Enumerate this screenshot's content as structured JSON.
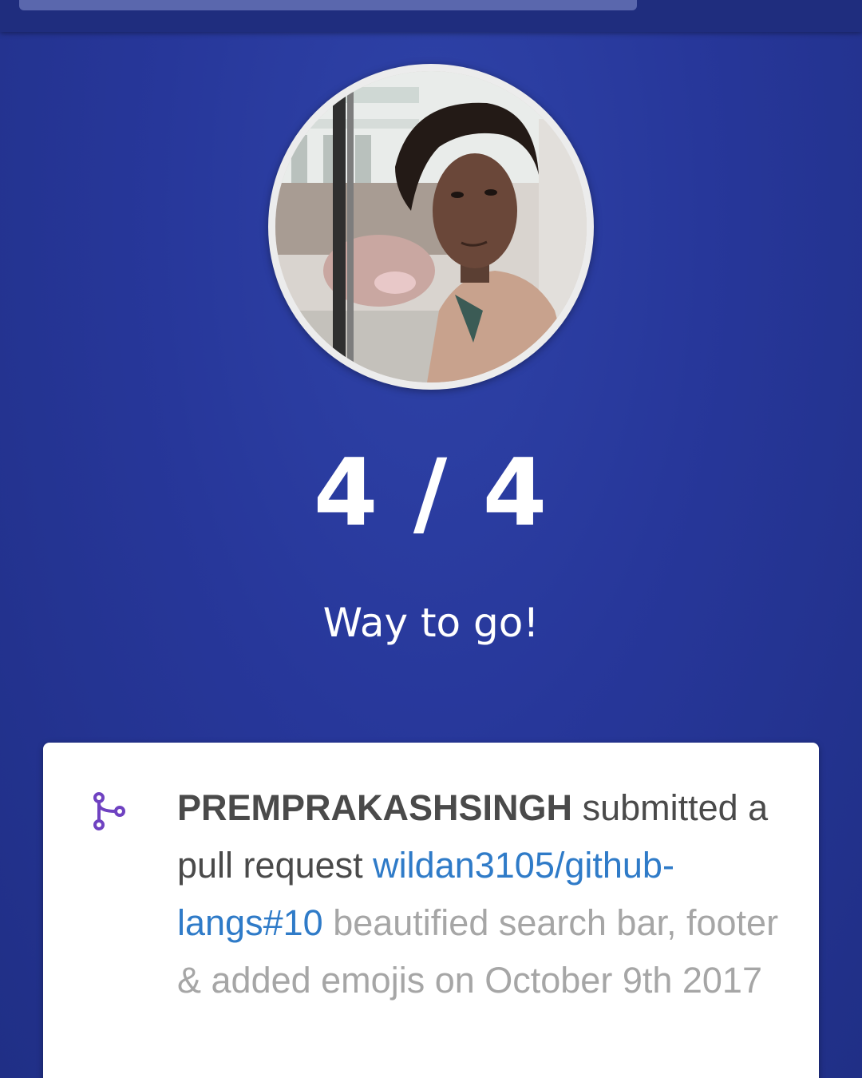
{
  "score": {
    "text": "4 / 4",
    "completed": 4,
    "total": 4
  },
  "tagline": "Way to go!",
  "activity": {
    "icon": "pull-request-icon",
    "actor": "PREMPRAKASHSINGH",
    "verb": "submitted a pull request",
    "link": "wildan3105/github-langs#10",
    "description": "beautified search bar, footer & added emojis on October 9th 2017"
  },
  "colors": {
    "background": "#27379a",
    "link": "#2f7bc8",
    "icon": "#6f42c1",
    "muted": "#a6a6a6"
  }
}
